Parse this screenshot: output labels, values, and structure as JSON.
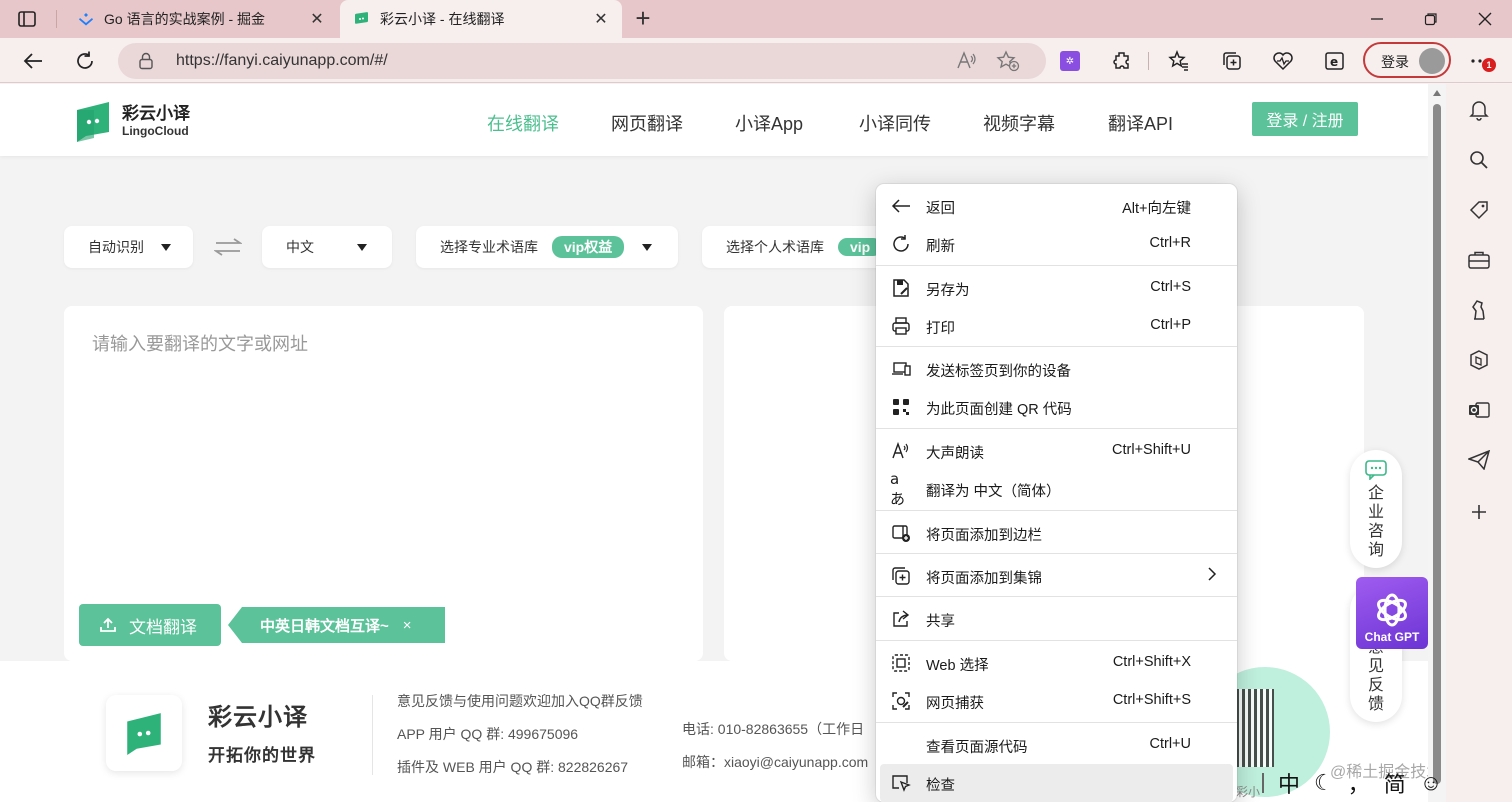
{
  "browser": {
    "tabs": [
      {
        "title": "Go 语言的实战案例 - 掘金"
      },
      {
        "title": "彩云小译 - 在线翻译"
      }
    ],
    "url": "https://fanyi.caiyunapp.com/#/",
    "login_label": "登录",
    "ext_badge": "1"
  },
  "site": {
    "logo_cn": "彩云小译",
    "logo_en": "LingoCloud",
    "nav": [
      "在线翻译",
      "网页翻译",
      "小译App",
      "小译同传",
      "视频字幕",
      "翻译API"
    ],
    "login_button": "登录 / 注册"
  },
  "translator": {
    "source_lang": "自动识别",
    "target_lang": "中文",
    "pro_glossary": "选择专业术语库",
    "personal_glossary": "选择个人术语库",
    "vip_badge": "vip权益",
    "vip_badge_short": "vip",
    "placeholder": "请输入要翻译的文字或网址",
    "doc_button": "文档翻译",
    "doc_tip": "中英日韩文档互译~",
    "doc_tip_close": "×"
  },
  "footer": {
    "name": "彩云小译",
    "slogan": "开拓你的世界",
    "feedback": "意见反馈与使用问题欢迎加入QQ群反馈",
    "app_qq": "APP 用户 QQ 群: 499675096",
    "web_qq": "插件及 WEB 用户 QQ 群: 822826267",
    "phone": "电话: 010-82863655（工作日",
    "email": "邮箱：xiaoyi@caiyunapp.com",
    "qr_caption": "彩小"
  },
  "floating": {
    "consult": "企业咨询",
    "feedback": "意见反馈",
    "chatgpt": "Chat GPT"
  },
  "context_menu": {
    "items": [
      {
        "label": "返回",
        "shortcut": "Alt+向左键",
        "icon": "back-arrow-icon"
      },
      {
        "label": "刷新",
        "shortcut": "Ctrl+R",
        "icon": "refresh-icon"
      },
      {
        "label": "另存为",
        "shortcut": "Ctrl+S",
        "icon": "save-as-icon"
      },
      {
        "label": "打印",
        "shortcut": "Ctrl+P",
        "icon": "print-icon"
      },
      {
        "label": "发送标签页到你的设备",
        "shortcut": "",
        "icon": "send-to-device-icon"
      },
      {
        "label": "为此页面创建 QR 代码",
        "shortcut": "",
        "icon": "qr-code-icon"
      },
      {
        "label": "大声朗读",
        "shortcut": "Ctrl+Shift+U",
        "icon": "read-aloud-icon"
      },
      {
        "label": "翻译为 中文（简体）",
        "shortcut": "",
        "icon": "translate-icon"
      },
      {
        "label": "将页面添加到边栏",
        "shortcut": "",
        "icon": "add-to-sidebar-icon"
      },
      {
        "label": "将页面添加到集锦",
        "shortcut": "",
        "icon": "add-to-collections-icon"
      },
      {
        "label": "共享",
        "shortcut": "",
        "icon": "share-icon"
      },
      {
        "label": "Web 选择",
        "shortcut": "Ctrl+Shift+X",
        "icon": "web-select-icon"
      },
      {
        "label": "网页捕获",
        "shortcut": "Ctrl+Shift+S",
        "icon": "web-capture-icon"
      },
      {
        "label": "查看页面源代码",
        "shortcut": "Ctrl+U",
        "icon": ""
      },
      {
        "label": "检查",
        "shortcut": "",
        "icon": "inspect-icon"
      }
    ]
  },
  "watermark": "@稀土掘金技术社区",
  "ime": {
    "mode": "中",
    "punct": "，",
    "script": "简"
  },
  "colors": {
    "brand_green": "#5bc29a",
    "nav_active": "#4cbf8f",
    "tabbar": "#e7c7c9",
    "toolbar": "#f7eeee",
    "login_border": "#c43a3a"
  }
}
